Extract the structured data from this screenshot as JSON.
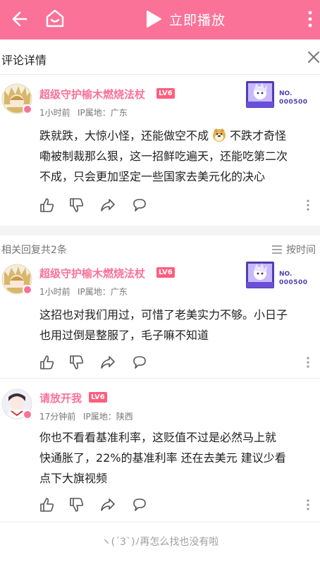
{
  "topbar": {
    "play_label": "立即播放",
    "accent": "#fb7299",
    "icons": [
      "back-arrow-icon",
      "home-tv-icon",
      "play-icon",
      "more-vertical-icon"
    ]
  },
  "subheader": {
    "title": "评论详情",
    "close_icon": "close-icon"
  },
  "main_comment": {
    "username": "超级守护榆木燃烧法杖",
    "level": "LV6",
    "time": "1小时前",
    "ip": "IP属地：广东",
    "text_line1": "跌就跌，大惊小怪，还能做空不成",
    "emoji": "doge",
    "text_line1b": "不跌才奇怪",
    "text_line2": "嘞被制裁那么狠，这一招鲜吃遍天，还能吃第二次",
    "text_line3": "不成，只会更加坚定一些国家去美元化的决心",
    "fan_badge_no": "NO.",
    "fan_badge_num": "000500"
  },
  "replies_header": {
    "count_label": "相关回复共2条",
    "sort_label": "按时间"
  },
  "replies": [
    {
      "username": "超级守护榆木燃烧法杖",
      "level": "LV6",
      "time": "1小时前",
      "ip": "IP属地：广东",
      "line1": "这招也对我们用过，可惜了老美实力不够。小日子",
      "line2": "也用过倒是整服了，毛子嘛不知道",
      "fan_badge_no": "NO.",
      "fan_badge_num": "000500"
    },
    {
      "username": "请放开我",
      "level": "LV6",
      "time": "17分钟前",
      "ip": "IP属地：陕西",
      "line1": "你也不看看基准利率，这贬值不过是必然马上就",
      "line2": "快通胀了，22%的基准利率 还在去美元 建议少看",
      "line3": "点下大旗视频"
    }
  ],
  "footer": {
    "text": "ヽ(ˊ3ˋ)ﾉ再怎么找也没有啦"
  }
}
